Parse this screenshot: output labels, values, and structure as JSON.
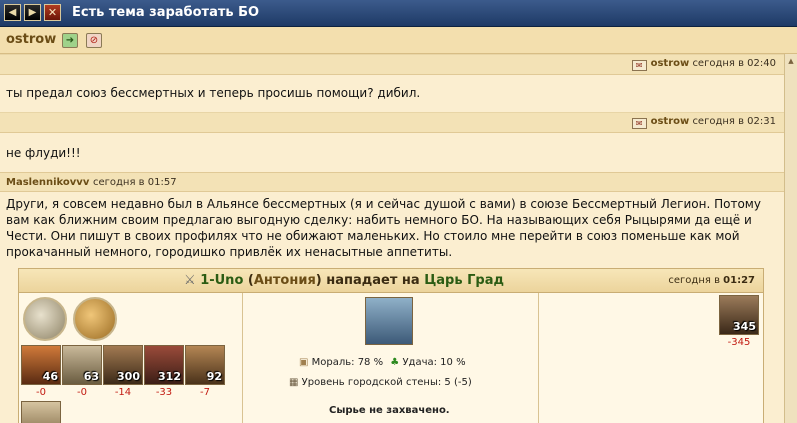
{
  "window": {
    "title": "Есть тема заработать БО",
    "buttons": [
      "◀",
      "▶",
      "✕"
    ]
  },
  "thread": {
    "author": "ostrow"
  },
  "messages": [
    {
      "author": "ostrow",
      "time": "сегодня в 02:40",
      "text": "ты предал союз бессмертных и теперь просишь помощи? дибил."
    },
    {
      "author": "ostrow",
      "time": "сегодня в 02:31",
      "text": "не флуди!!!"
    }
  ],
  "post": {
    "author": "Maslennikovvv",
    "time": "сегодня в 01:57",
    "text": "Други, я совсем недавно был в Альянсе бессмертных (я и сейчас душой с вами) в союзе Бессмертный Легион. Потому вам как ближним своим предлагаю выгодную сделку: набить немного БО. На называющих себя Рыцырями да ещё и Чести. Они пишут в своих профилях что не обижают маленьких. Но стоило мне перейти в союз поменьше как мой прокачанный немного, городишко привлёк их ненасытные аппетиты."
  },
  "report": {
    "attacker": "1-Uno",
    "attacker_city": "Антония",
    "verb": "нападает на",
    "target": "Царь Град",
    "time_prefix": "сегодня в",
    "time": "01:27",
    "attacker_units": [
      {
        "count": "46",
        "loss": "-0"
      },
      {
        "count": "63",
        "loss": "-0"
      },
      {
        "count": "300",
        "loss": "-14"
      },
      {
        "count": "312",
        "loss": "-33"
      },
      {
        "count": "92",
        "loss": "-7"
      }
    ],
    "defender_units": [
      {
        "count": "345",
        "loss": "-345"
      }
    ],
    "morale": "Мораль: 78 %",
    "luck": "Удача: 10 %",
    "wall": "Уровень городской стены: 5 (-5)",
    "resources": "Сырье не захвачено."
  }
}
